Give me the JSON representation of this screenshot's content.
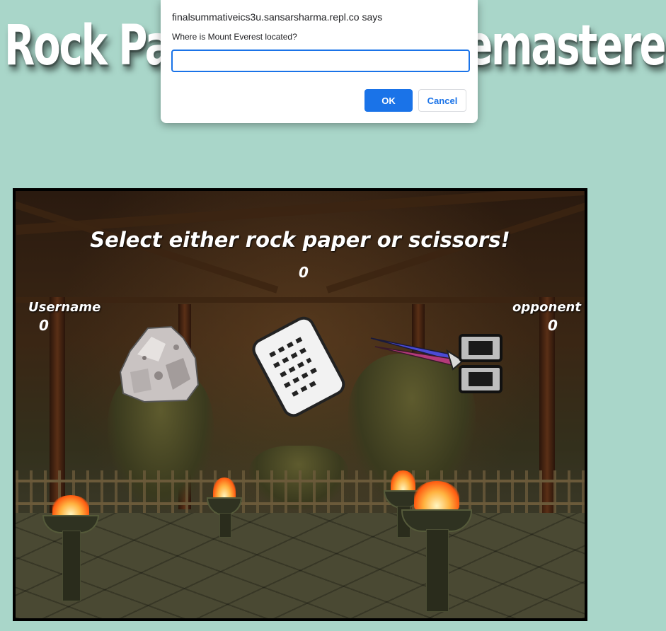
{
  "page": {
    "title": "Rock Paper Scissors Remastered"
  },
  "dialog": {
    "origin_text": "finalsummativeics3u.sansarsharma.repl.co says",
    "message": "Where is Mount Everest located?",
    "input_value": "",
    "ok_label": "OK",
    "cancel_label": "Cancel",
    "colors": {
      "primary": "#1a73e8"
    }
  },
  "game": {
    "prompt": "Select either rock paper or scissors!",
    "round_score": "0",
    "player": {
      "label": "Username",
      "score": "0"
    },
    "opponent": {
      "label": "opponent",
      "score": "0"
    },
    "choices": [
      {
        "name": "rock",
        "icon": "rock-icon"
      },
      {
        "name": "paper",
        "icon": "paper-icon"
      },
      {
        "name": "scissors",
        "icon": "scissors-icon"
      }
    ]
  },
  "colors": {
    "page_background": "#a9d6c9",
    "board_border": "#000000"
  }
}
